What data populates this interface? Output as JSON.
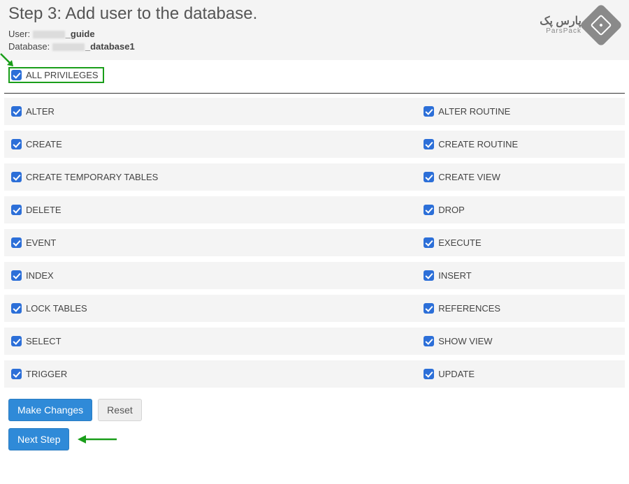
{
  "title": "Step 3: Add user to the database.",
  "meta": {
    "user_label": "User: ",
    "user_suffix": "_guide",
    "db_label": "Database: ",
    "db_suffix": "_database1"
  },
  "logo": {
    "fa": "پارس پک",
    "en": "ParsPack"
  },
  "all_privileges": {
    "label": "ALL PRIVILEGES",
    "checked": true
  },
  "privileges": [
    {
      "left": "ALTER",
      "right": "ALTER ROUTINE"
    },
    {
      "left": "CREATE",
      "right": "CREATE ROUTINE"
    },
    {
      "left": "CREATE TEMPORARY TABLES",
      "right": "CREATE VIEW"
    },
    {
      "left": "DELETE",
      "right": "DROP"
    },
    {
      "left": "EVENT",
      "right": "EXECUTE"
    },
    {
      "left": "INDEX",
      "right": "INSERT"
    },
    {
      "left": "LOCK TABLES",
      "right": "REFERENCES"
    },
    {
      "left": "SELECT",
      "right": "SHOW VIEW"
    },
    {
      "left": "TRIGGER",
      "right": "UPDATE"
    }
  ],
  "buttons": {
    "make_changes": "Make Changes",
    "reset": "Reset",
    "next_step": "Next Step"
  },
  "colors": {
    "accent": "#2c6fd8",
    "annotation": "#1a9e1a"
  }
}
